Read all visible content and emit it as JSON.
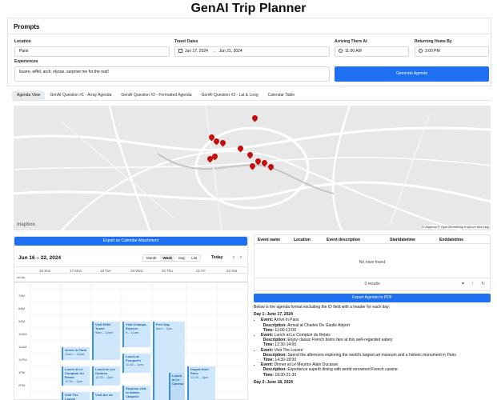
{
  "page_title": "GenAI Trip Planner",
  "prompts": {
    "title": "Prompts",
    "location_label": "Location",
    "location_value": "Paris",
    "dates_label": "Travel Dates",
    "date_start": "Jun 17, 2024",
    "date_sep": "→",
    "date_end": "Jun 21, 2024",
    "arrive_label": "Arriving There At",
    "arrive_value": "11:00 AM",
    "return_label": "Returning Home By",
    "return_value": "3:00 PM",
    "experiences_label": "Experiences",
    "experiences_value": "louvre, eiffel, arch, elysse, surprise me for the rest!",
    "generate_label": "Generate Agenda"
  },
  "tabs": [
    "Agenda View",
    "GenAI Question #1 - Array Agenda",
    "GenAI Question #2 - Formatted Agenda",
    "GenAI Question #3 - Lat & Long",
    "Calendar Table"
  ],
  "map": {
    "attribution": "© Mapbox © OpenStreetMap Improve this map",
    "logo": "mapbox"
  },
  "calendar": {
    "export_label": "Export as Calendar Attachment",
    "range": "Jun 16 – 22, 2024",
    "views": [
      "Month",
      "Week",
      "Day",
      "List"
    ],
    "today_label": "Today",
    "days": [
      "16 Sun",
      "17 Mon",
      "18 Tue",
      "19 Wed",
      "20 Thu",
      "21 Fri",
      "22 Sat"
    ],
    "allday_label": "all-day",
    "hours": [
      "7AM",
      "8AM",
      "9AM",
      "10AM",
      "11AM",
      "12PM",
      "1PM",
      "2PM"
    ],
    "events": [
      {
        "title": "Arrive in Paris",
        "time": "11am – 12pm"
      },
      {
        "title": "Lunch at Le Comptoir du Relais",
        "time": "12:30 – 2pm"
      },
      {
        "title": "Visit The Louvre",
        "time": ""
      },
      {
        "title": "Visit Eiffel Tower",
        "time": "9am – 12pm"
      },
      {
        "title": "Lunch at Les Ombres",
        "time": "12:30 – 2pm"
      },
      {
        "title": "Visit Arc de",
        "time": ""
      },
      {
        "title": "Visit Champs-Elysées",
        "time": "9 – 11am"
      },
      {
        "title": "Lunch at Fouquet's",
        "time": "11:30 – 1pm"
      },
      {
        "title": "Surprise visit to Sainte-Chapelle",
        "time": ""
      },
      {
        "title": "Free Day",
        "time": "9am – 7pm"
      },
      {
        "title": "Lunch at Le Caveau",
        "time": ""
      },
      {
        "title": "Depart from Paris",
        "time": "12:30 – 3pm"
      }
    ]
  },
  "table": {
    "headers": [
      "Event name",
      "Location",
      "Event description",
      "Startdatetime",
      "Enddatetime"
    ],
    "empty": "No rows found",
    "footer": "0 results"
  },
  "export_pdf_label": "Export Agenda to PDF",
  "agenda": {
    "intro": "Below is the agenda format excluding the ID field with a header for each day:",
    "day1": "Day 1: June 17, 2024",
    "items": [
      {
        "event": "Arrive in Paris",
        "description": "Arrival at Charles De Gaulle Airport",
        "time": "11:00-12:00"
      },
      {
        "event": "Lunch at Le Comptoir du Relais",
        "description": "Enjoy classic French bistro fare at this well-regarded eatery",
        "time": "12:30-14:00"
      },
      {
        "event": "Visit The Louvre",
        "description": "Spend the afternoon exploring the world's largest art museum and a historic monument in Paris",
        "time": "14:30-18:00"
      },
      {
        "event": "Dinner at Le Meurice Alain Ducasse",
        "description": "Experience superb dining with world renowned French cuisine",
        "time": "18:30-21:30"
      }
    ],
    "labels": {
      "event": "Event:",
      "description": "Description:",
      "time": "Time:"
    },
    "day2": "Day 2: June 18, 2024"
  }
}
